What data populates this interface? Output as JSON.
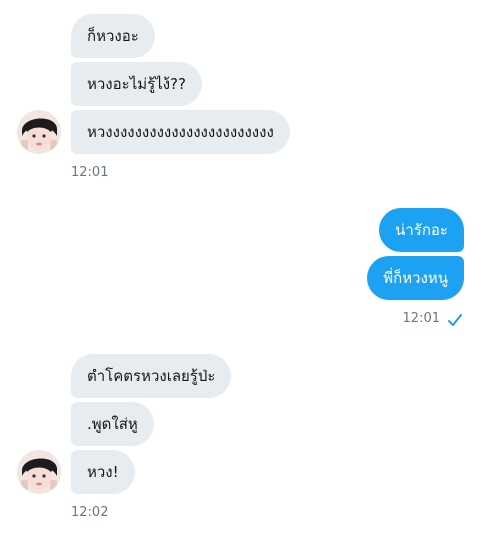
{
  "conversation": {
    "group1": {
      "messages": [
        "ก็หวงอะ",
        "หวงอะไม่รู้ไง้??",
        "หวงงงงงงงงงงงงงงงงงงงงงงง"
      ],
      "timestamp": "12:01"
    },
    "group2": {
      "messages": [
        "น่ารักอะ",
        "พี่ก็หวงหนู"
      ],
      "timestamp": "12:01",
      "status_icon": "checkmark-sent-icon"
    },
    "group3": {
      "messages": [
        "ตำโคตรหวงเลยรู้ป่ะ",
        ".พูดใส่หู",
        "หวง!"
      ],
      "timestamp": "12:02"
    }
  },
  "colors": {
    "incoming_bubble": "#e6ecf0",
    "outgoing_bubble": "#1da1f2",
    "timestamp": "#657786"
  }
}
